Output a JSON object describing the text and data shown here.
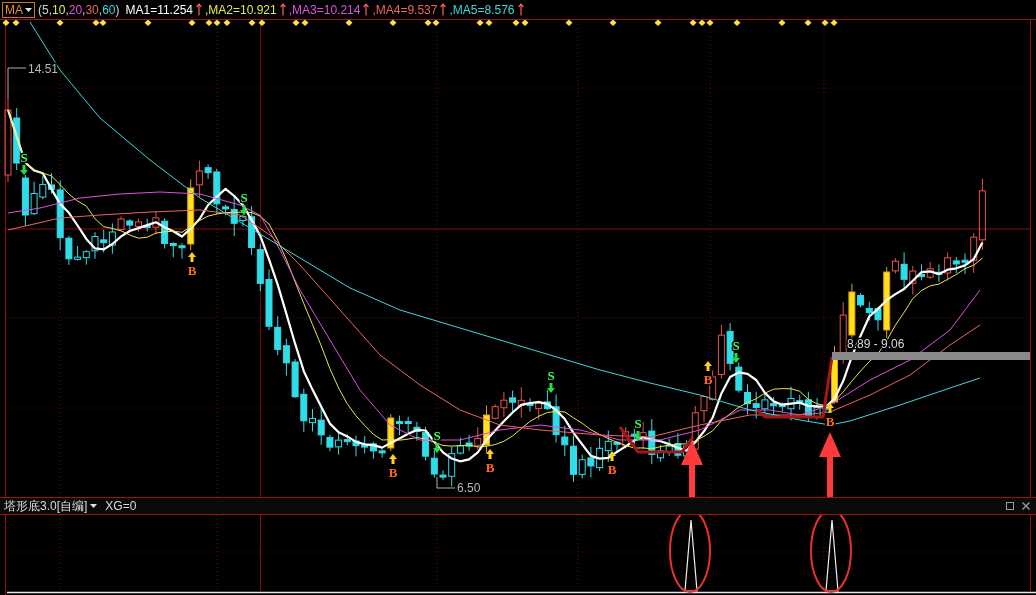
{
  "indicator_bar": {
    "selector": {
      "label": "MA"
    },
    "parameters": [
      {
        "text": "(5,"
      },
      {
        "text": "10",
        "color": "#e8e84a"
      },
      {
        "text": ","
      },
      {
        "text": "20",
        "color": "#e050e0"
      },
      {
        "text": ","
      },
      {
        "text": "30",
        "color": "#f06262"
      },
      {
        "text": ","
      },
      {
        "text": "60",
        "color": "#3fd8d8"
      },
      {
        "text": ")"
      }
    ],
    "values": [
      {
        "text": "MA1=11.254",
        "color": "#ffffff",
        "rising": true
      },
      {
        "text": ",MA2=10.921",
        "color": "#e8e84a",
        "rising": true
      },
      {
        "text": ",MA3=10.214",
        "color": "#e050e0",
        "rising": true
      },
      {
        "text": ",MA4=9.537",
        "color": "#f06262",
        "rising": true
      },
      {
        "text": ",MA5=8.576",
        "color": "#3fd8d8",
        "rising": true
      }
    ]
  },
  "chart": {
    "high_label": "14.51",
    "low_label": "6.50",
    "range_label": "8.89 - 9.06",
    "signals": [
      {
        "kind": "sell",
        "text": "S"
      },
      {
        "kind": "buy",
        "text": "B"
      },
      {
        "kind": "sell",
        "text": "S"
      },
      {
        "kind": "buy",
        "text": "B"
      },
      {
        "kind": "sell",
        "text": "S"
      },
      {
        "kind": "buy",
        "text": "B"
      },
      {
        "kind": "sell",
        "text": "S"
      },
      {
        "kind": "buy",
        "text": "B"
      },
      {
        "kind": "sell",
        "text": "S"
      },
      {
        "kind": "buy",
        "text": "B"
      },
      {
        "kind": "sell",
        "text": "S"
      },
      {
        "kind": "buy",
        "text": "B"
      }
    ]
  },
  "lower_panel": {
    "selector": {
      "label": "塔形底3.0[自编]"
    },
    "value": "XG=0"
  }
}
